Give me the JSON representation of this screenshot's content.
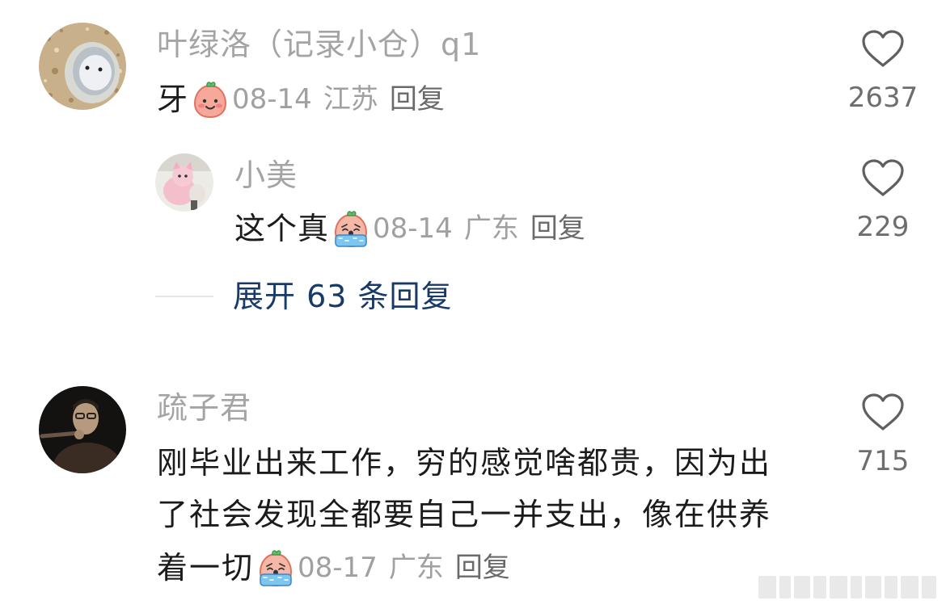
{
  "comments": [
    {
      "username": "叶绿洛（记录小仓）q1",
      "text": "牙",
      "date": "08-14",
      "location": "江苏",
      "reply_label": "回复",
      "likes": "2637",
      "emoji": "smile-bun-emoji"
    },
    {
      "username": "小美",
      "text": "这个真",
      "date": "08-14",
      "location": "广东",
      "reply_label": "回复",
      "likes": "229",
      "emoji": "crying-bun-emoji"
    },
    {
      "username": "疏子君",
      "lines": [
        "刚毕业出来工作，穷的感觉啥都贵，因为出",
        "了社会发现全都要自己一并支出，像在供养",
        "着一切"
      ],
      "date": "08-17",
      "location": "广东",
      "reply_label": "回复",
      "likes": "715",
      "emoji": "crying-bun-emoji"
    }
  ],
  "expand_replies": "展开 63 条回复",
  "colors": {
    "username": "#a4a4a4",
    "body": "#1b1b1b",
    "meta": "#a0a0a0",
    "link": "#183a68",
    "like_icon": "#5f5f5f"
  }
}
